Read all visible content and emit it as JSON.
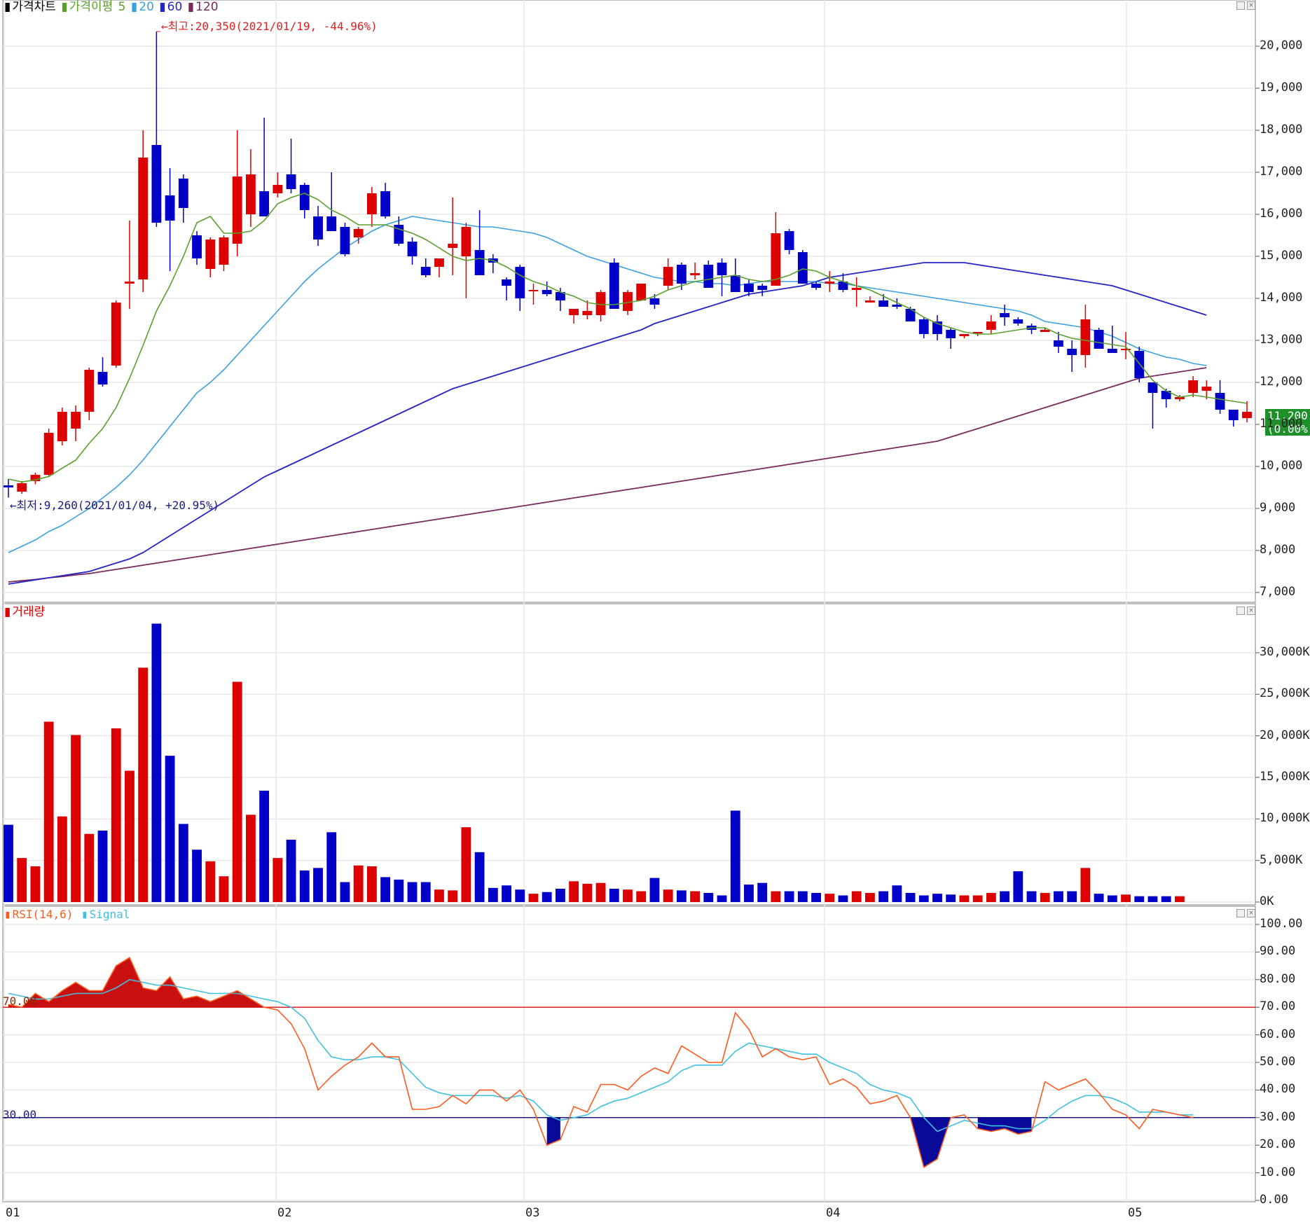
{
  "colors": {
    "up": "#dd0000",
    "down": "#0000c8",
    "ma5": "#5aa02c",
    "ma20": "#3aa0e0",
    "ma60": "#2424c8",
    "ma120": "#7a2a5a",
    "rsi": "#ff5a1e",
    "signal": "#40c0e0",
    "grid": "#e8e8e8",
    "high_line": "#e02020",
    "low_line": "#1a1a80"
  },
  "price_panel": {
    "legend": {
      "title": "가격차트",
      "ma_label": "가격이평",
      "ma5": "5",
      "ma20": "20",
      "ma60": "60",
      "ma120": "120"
    },
    "high_annotation": "←최고:20,350(2021/01/19, -44.96%)",
    "low_annotation": "←최저:9,260(2021/01/04, +20.95%)",
    "current_price": "11,200",
    "current_change": "(0.00%)",
    "y_ticks": [
      "20,000",
      "19,000",
      "18,000",
      "17,000",
      "16,000",
      "15,000",
      "14,000",
      "13,000",
      "12,000",
      "11,000",
      "10,000",
      "9,000",
      "8,000",
      "7,000"
    ]
  },
  "volume_panel": {
    "legend": "거래량",
    "y_ticks": [
      "30,000K",
      "25,000K",
      "20,000K",
      "15,000K",
      "10,000K",
      "5,000K",
      "0K"
    ]
  },
  "rsi_panel": {
    "legend_rsi": "RSI(14,6)",
    "legend_signal": "Signal",
    "level_high": "70.00",
    "level_low": "30.00",
    "y_ticks": [
      "100.00",
      "90.00",
      "80.00",
      "70.00",
      "60.00",
      "50.00",
      "40.00",
      "30.00",
      "20.00",
      "10.00",
      "0.00"
    ]
  },
  "x_axis": {
    "labels": [
      "01",
      "02",
      "03",
      "04",
      "05"
    ]
  },
  "chart_data": {
    "type": "candlestick",
    "candles": [
      [
        9550,
        9700,
        9260,
        9500
      ],
      [
        9400,
        9650,
        9350,
        9600
      ],
      [
        9650,
        9850,
        9580,
        9800
      ],
      [
        9800,
        10900,
        9750,
        10800
      ],
      [
        10600,
        11400,
        10500,
        11300
      ],
      [
        10900,
        11450,
        10600,
        11300
      ],
      [
        11300,
        12350,
        11100,
        12300
      ],
      [
        12250,
        12600,
        11900,
        11950
      ],
      [
        12400,
        13950,
        12350,
        13900
      ],
      [
        14350,
        15850,
        13750,
        14400
      ],
      [
        14450,
        18000,
        14150,
        17350
      ],
      [
        17650,
        20350,
        15700,
        15800
      ],
      [
        16450,
        17100,
        14650,
        15850
      ],
      [
        16850,
        16950,
        15800,
        16150
      ],
      [
        15500,
        15600,
        14800,
        14950
      ],
      [
        14700,
        15450,
        14500,
        15400
      ],
      [
        14800,
        15500,
        14650,
        15450
      ],
      [
        15300,
        18000,
        15000,
        16900
      ],
      [
        16000,
        17550,
        15700,
        16950
      ],
      [
        16550,
        18300,
        16000,
        15950
      ],
      [
        16500,
        17000,
        16400,
        16700
      ],
      [
        16950,
        17800,
        16500,
        16600
      ],
      [
        16700,
        16750,
        15900,
        16100
      ],
      [
        15950,
        16200,
        15250,
        15400
      ],
      [
        15950,
        17000,
        15700,
        15600
      ],
      [
        15700,
        15800,
        15000,
        15050
      ],
      [
        15450,
        15700,
        15300,
        15650
      ],
      [
        16000,
        16650,
        15700,
        16500
      ],
      [
        16550,
        16750,
        15900,
        15950
      ],
      [
        15750,
        15950,
        15250,
        15300
      ],
      [
        15350,
        15450,
        14800,
        15000
      ],
      [
        14750,
        14950,
        14500,
        14550
      ],
      [
        14750,
        14950,
        14500,
        14950
      ],
      [
        15200,
        16400,
        14550,
        15300
      ],
      [
        15000,
        15800,
        14000,
        15700
      ],
      [
        15150,
        16100,
        14600,
        14550
      ],
      [
        14950,
        15050,
        14600,
        14850
      ],
      [
        14450,
        14500,
        13950,
        14300
      ],
      [
        14750,
        14800,
        13700,
        14000
      ],
      [
        14200,
        14350,
        13850,
        14200
      ],
      [
        14200,
        14400,
        14050,
        14100
      ],
      [
        14150,
        14250,
        13700,
        13950
      ],
      [
        13600,
        13600,
        13400,
        13750
      ],
      [
        13600,
        13950,
        13500,
        13700
      ],
      [
        13600,
        14200,
        13450,
        14150
      ],
      [
        14850,
        14950,
        13750,
        13750
      ],
      [
        13700,
        14200,
        13600,
        14150
      ],
      [
        13950,
        14300,
        13950,
        14350
      ],
      [
        14000,
        14100,
        13750,
        13850
      ],
      [
        14300,
        14950,
        14200,
        14750
      ],
      [
        14800,
        14850,
        14200,
        14350
      ],
      [
        14550,
        14850,
        14450,
        14600
      ],
      [
        14800,
        14900,
        14350,
        14250
      ],
      [
        14850,
        14950,
        14050,
        14550
      ],
      [
        14550,
        14950,
        14300,
        14150
      ],
      [
        14350,
        14450,
        14050,
        14150
      ],
      [
        14300,
        14350,
        14050,
        14200
      ],
      [
        14300,
        16050,
        14300,
        15550
      ],
      [
        15600,
        15650,
        15050,
        15150
      ],
      [
        15100,
        15150,
        14350,
        14350
      ],
      [
        14350,
        14400,
        14200,
        14250
      ],
      [
        14350,
        14650,
        14150,
        14400
      ],
      [
        14400,
        14600,
        14150,
        14200
      ],
      [
        14200,
        14500,
        13800,
        14250
      ],
      [
        13900,
        14050,
        13900,
        13950
      ],
      [
        13950,
        14100,
        13850,
        13800
      ],
      [
        13850,
        14000,
        13750,
        13800
      ],
      [
        13750,
        13800,
        13450,
        13450
      ],
      [
        13500,
        13550,
        13050,
        13150
      ],
      [
        13450,
        13600,
        13000,
        13150
      ],
      [
        13250,
        13300,
        12800,
        13050
      ],
      [
        13100,
        13100,
        13050,
        13150
      ],
      [
        13200,
        13200,
        13100,
        13200
      ],
      [
        13250,
        13600,
        13150,
        13450
      ],
      [
        13650,
        13850,
        13350,
        13550
      ],
      [
        13500,
        13550,
        13350,
        13400
      ],
      [
        13350,
        13400,
        13150,
        13250
      ],
      [
        13200,
        13300,
        13200,
        13250
      ],
      [
        13000,
        13200,
        12700,
        12850
      ],
      [
        12800,
        13000,
        12250,
        12650
      ],
      [
        12650,
        13850,
        12350,
        13500
      ],
      [
        13250,
        13300,
        12800,
        12800
      ],
      [
        12800,
        13350,
        12700,
        12700
      ],
      [
        12800,
        13200,
        12550,
        12800
      ],
      [
        12750,
        12850,
        12000,
        12100
      ],
      [
        12000,
        12000,
        10900,
        11750
      ],
      [
        11800,
        11850,
        11400,
        11600
      ],
      [
        11600,
        11700,
        11550,
        11650
      ],
      [
        11750,
        12150,
        11650,
        12050
      ],
      [
        11800,
        12050,
        11600,
        11900
      ],
      [
        11750,
        12050,
        11250,
        11350
      ],
      [
        11350,
        11300,
        10950,
        11100
      ],
      [
        11150,
        11550,
        11050,
        11300
      ]
    ],
    "volume_k": [
      9300,
      5300,
      4300,
      21700,
      10300,
      20100,
      8200,
      8600,
      20900,
      15800,
      28200,
      33500,
      17600,
      9400,
      6300,
      4900,
      3100,
      26500,
      10500,
      13400,
      5300,
      7500,
      3800,
      4100,
      8400,
      2400,
      4400,
      4300,
      3000,
      2700,
      2400,
      2400,
      1500,
      1400,
      9000,
      6000,
      1700,
      2000,
      1500,
      1000,
      1200,
      1600,
      2500,
      2200,
      2300,
      1600,
      1500,
      1300,
      2900,
      1500,
      1400,
      1300,
      1100,
      800,
      11000,
      2100,
      2300,
      1300,
      1300,
      1300,
      1100,
      1000,
      800,
      1300,
      1100,
      1300,
      2000,
      1100,
      800,
      1000,
      900,
      800,
      800,
      1100,
      1300,
      3700,
      1300,
      1100,
      1300,
      1300,
      4100,
      1000,
      800,
      900,
      700,
      700,
      700,
      700
    ],
    "ma5": [
      9700,
      9630,
      9680,
      9760,
      9960,
      10150,
      10550,
      10900,
      11400,
      12100,
      12880,
      13700,
      14300,
      15000,
      15800,
      15950,
      15550,
      15550,
      15600,
      15850,
      16250,
      16400,
      16500,
      16350,
      16100,
      15950,
      15750,
      15750,
      15750,
      15650,
      15550,
      15400,
      15200,
      15000,
      14900,
      14950,
      14900,
      14750,
      14550,
      14400,
      14300,
      14150,
      14050,
      13900,
      13850,
      13850,
      13900,
      13950,
      14050,
      14200,
      14300,
      14400,
      14450,
      14500,
      14550,
      14450,
      14400,
      14450,
      14550,
      14700,
      14650,
      14500,
      14400,
      14300,
      14200,
      14050,
      13900,
      13750,
      13550,
      13400,
      13300,
      13200,
      13150,
      13150,
      13200,
      13250,
      13300,
      13300,
      13150,
      13050,
      13000,
      12950,
      12900,
      12850,
      12450,
      12050,
      11800,
      11650,
      11700,
      11650,
      11600,
      11550,
      11500
    ],
    "ma20": [
      7950,
      8100,
      8250,
      8450,
      8600,
      8800,
      9000,
      9250,
      9500,
      9800,
      10150,
      10550,
      10950,
      11350,
      11750,
      12000,
      12300,
      12650,
      13000,
      13350,
      13700,
      14050,
      14400,
      14700,
      14950,
      15200,
      15400,
      15600,
      15750,
      15850,
      15950,
      15900,
      15850,
      15800,
      15750,
      15700,
      15700,
      15650,
      15600,
      15550,
      15450,
      15300,
      15150,
      15000,
      14900,
      14800,
      14700,
      14600,
      14500,
      14450,
      14400,
      14400,
      14350,
      14350,
      14300,
      14350,
      14400,
      14400,
      14400,
      14400,
      14400,
      14350,
      14350,
      14300,
      14250,
      14200,
      14150,
      14100,
      14050,
      14000,
      13950,
      13900,
      13850,
      13800,
      13750,
      13700,
      13600,
      13450,
      13400,
      13350,
      13300,
      13200,
      13100,
      12950,
      12800,
      12700,
      12600,
      12550,
      12450,
      12400
    ],
    "ma60": [
      7200,
      7250,
      7300,
      7350,
      7400,
      7450,
      7500,
      7600,
      7700,
      7800,
      7950,
      8150,
      8350,
      8550,
      8750,
      8950,
      9150,
      9350,
      9550,
      9750,
      9900,
      10050,
      10200,
      10350,
      10500,
      10650,
      10800,
      10950,
      11100,
      11250,
      11400,
      11550,
      11700,
      11850,
      11950,
      12050,
      12150,
      12250,
      12350,
      12450,
      12550,
      12650,
      12750,
      12850,
      12950,
      13050,
      13150,
      13250,
      13400,
      13500,
      13600,
      13700,
      13800,
      13900,
      14000,
      14100,
      14150,
      14200,
      14250,
      14300,
      14400,
      14500,
      14550,
      14600,
      14650,
      14700,
      14750,
      14800,
      14850,
      14850,
      14850,
      14850,
      14800,
      14750,
      14700,
      14650,
      14600,
      14550,
      14500,
      14450,
      14400,
      14350,
      14300,
      14200,
      14100,
      14000,
      13900,
      13800,
      13700,
      13600
    ],
    "ma120": [
      7250,
      7280,
      7310,
      7350,
      7380,
      7420,
      7450,
      7500,
      7550,
      7600,
      7650,
      7700,
      7750,
      7800,
      7850,
      7900,
      7950,
      8000,
      8050,
      8100,
      8150,
      8200,
      8250,
      8300,
      8350,
      8400,
      8450,
      8500,
      8550,
      8600,
      8650,
      8700,
      8750,
      8800,
      8850,
      8900,
      8950,
      9000,
      9050,
      9100,
      9150,
      9200,
      9250,
      9300,
      9350,
      9400,
      9450,
      9500,
      9550,
      9600,
      9650,
      9700,
      9750,
      9800,
      9850,
      9900,
      9950,
      10000,
      10050,
      10100,
      10150,
      10200,
      10250,
      10300,
      10350,
      10400,
      10450,
      10500,
      10550,
      10600,
      10700,
      10800,
      10900,
      11000,
      11100,
      11200,
      11300,
      11400,
      11500,
      11600,
      11700,
      11800,
      11900,
      12000,
      12100,
      12150,
      12200,
      12250,
      12300,
      12350
    ],
    "rsi": [
      71,
      70,
      75,
      72,
      76,
      79,
      76,
      76,
      85,
      88,
      77,
      76,
      81,
      73,
      74,
      72,
      74,
      76,
      73,
      70,
      69,
      64,
      55,
      40,
      45,
      49,
      52,
      57,
      52,
      52,
      33,
      33,
      34,
      38,
      35,
      40,
      40,
      36,
      40,
      33,
      20,
      22,
      34,
      32,
      42,
      42,
      40,
      45,
      48,
      46,
      56,
      53,
      50,
      50,
      68,
      62,
      52,
      55,
      52,
      51,
      52,
      42,
      44,
      41,
      35,
      36,
      38,
      30,
      12,
      15,
      30,
      31,
      26,
      25,
      26,
      24,
      25,
      43,
      40,
      42,
      44,
      39,
      33,
      31,
      26,
      33,
      32,
      31,
      30
    ],
    "signal": [
      75,
      74,
      73,
      73,
      74,
      75,
      75,
      75,
      77,
      80,
      79,
      78,
      78,
      77,
      76,
      75,
      75,
      75,
      74,
      73,
      72,
      70,
      66,
      58,
      52,
      51,
      51,
      52,
      52,
      51,
      46,
      41,
      39,
      38,
      38,
      38,
      38,
      37,
      38,
      36,
      31,
      29,
      30,
      31,
      34,
      36,
      37,
      39,
      41,
      43,
      47,
      49,
      49,
      49,
      54,
      57,
      56,
      55,
      54,
      53,
      53,
      50,
      48,
      46,
      42,
      40,
      39,
      37,
      30,
      25,
      27,
      29,
      28,
      27,
      27,
      26,
      26,
      29,
      33,
      36,
      38,
      38,
      37,
      35,
      32,
      32,
      32,
      31,
      31
    ],
    "price_range": [
      7000,
      20400
    ],
    "volume_range": [
      0,
      33500
    ],
    "rsi_range": [
      0,
      100
    ]
  }
}
